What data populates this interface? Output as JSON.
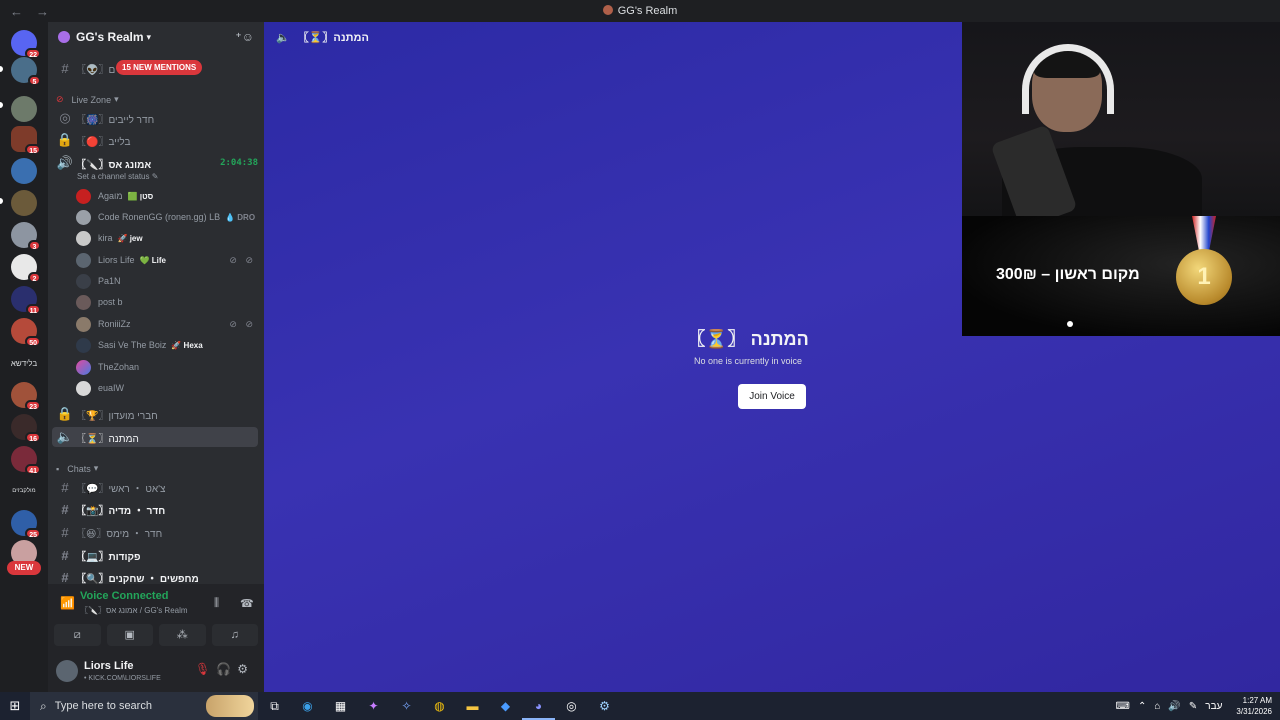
{
  "titlebar": {
    "back": "←",
    "forward": "→",
    "title": "GG's Realm"
  },
  "servers": {
    "badges": [
      "22",
      "5",
      "15",
      "3",
      "2",
      "11",
      "50",
      "23",
      "16",
      "41",
      "25"
    ],
    "label_a": "בלידשא",
    "label_b": "מולקבזים",
    "new_label": "NEW"
  },
  "sidebar": {
    "server_name": "GG's Realm",
    "mention_pill": "15 NEW MENTIONS",
    "top_channel": "〖👽〗ם",
    "cat_live": "Live Zone",
    "live_channels": [
      {
        "name": "〖🎆〗חדר לייבים"
      },
      {
        "name": "〖🔴〗בלייב"
      },
      {
        "name": "〖🔪〗אמונג אס",
        "timer": "2:04:38"
      }
    ],
    "channel_status": "Set a channel status ✎",
    "voice_users": [
      {
        "name": "Agaמו",
        "tag": "🟩 סטן"
      },
      {
        "name": "Code RonenGG (ronen.gg) LB",
        "tag": "💧 DRO"
      },
      {
        "name": "kira",
        "tag": "🚀 jew"
      },
      {
        "name": "Liors Life",
        "tag": "💚 Life",
        "mute": "⊘ ⊘"
      },
      {
        "name": "Pa1N",
        "tag": ""
      },
      {
        "name": "post b",
        "tag": ""
      },
      {
        "name": "RoniiiZz",
        "tag": "",
        "mute": "⊘ ⊘"
      },
      {
        "name": "Sasi Ve The Boiz",
        "tag": "🚀 Hexa"
      },
      {
        "name": "TheZohan",
        "tag": ""
      },
      {
        "name": "euaIW",
        "tag": ""
      }
    ],
    "club_channel": "〖🏆〗חברי מועדון",
    "selected_channel": "〖⏳〗המתנה",
    "cat_chats": "Chats",
    "chat_channels": [
      {
        "name": "〖💬〗צ'אט ・ ראשי",
        "bold": false
      },
      {
        "name": "〖📸〗חדר ・ מדיה",
        "bold": true
      },
      {
        "name": "〖😆〗חדר ・ מימס",
        "bold": false
      },
      {
        "name": "〖💻〗פקודות",
        "bold": true
      },
      {
        "name": "〖🔍〗מחפשים ・ שחקנים",
        "bold": true
      }
    ]
  },
  "voice_panel": {
    "title": "Voice Connected",
    "subtitle": "〖🔪〗אמונג אס / GG's Realm",
    "user_name": "Liors Life",
    "user_status": "• KICK.COM\\LIORSLIFE"
  },
  "main": {
    "header_channel": "〖⏳〗המתנה",
    "empty_title": "〖⏳〗 המתנה",
    "empty_sub": "No one is currently in voice",
    "join_label": "Join Voice"
  },
  "overlay": {
    "prize_text": "300₪ – מקום ראשון",
    "medal_digit": "1"
  },
  "taskbar": {
    "search_placeholder": "Type here to search",
    "lang": "עבר",
    "time": "1:27 AM",
    "date": "3/31/2026"
  },
  "colors": {
    "accent_green": "#23a55a",
    "badge_red": "#da373c",
    "stage_bg": "#3932b2"
  }
}
